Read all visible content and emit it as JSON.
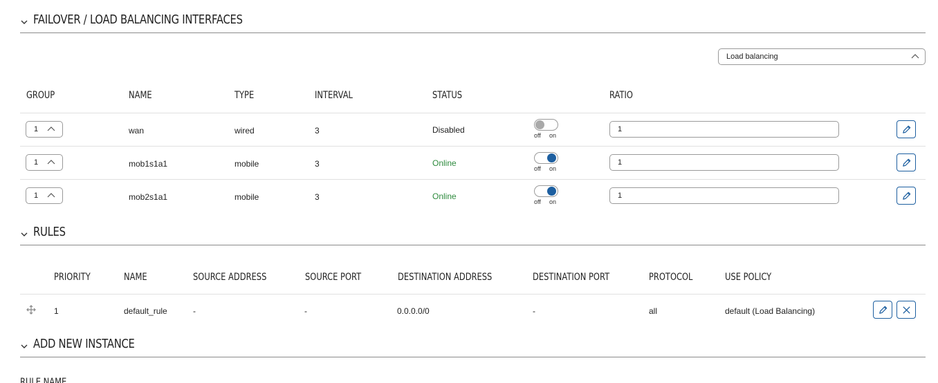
{
  "failover_section": {
    "title": "FAILOVER / LOAD BALANCING INTERFACES"
  },
  "mode_select": {
    "value": "Load balancing"
  },
  "interfaces": {
    "headers": {
      "group": "GROUP",
      "name": "NAME",
      "type": "TYPE",
      "interval": "INTERVAL",
      "status": "STATUS",
      "ratio": "RATIO"
    },
    "rows": [
      {
        "group": "1",
        "name": "wan",
        "type": "wired",
        "interval": "3",
        "status": "Disabled",
        "enabled": false,
        "toggle_off": "off",
        "toggle_on": "on",
        "ratio": "1"
      },
      {
        "group": "1",
        "name": "mob1s1a1",
        "type": "mobile",
        "interval": "3",
        "status": "Online",
        "enabled": true,
        "toggle_off": "off",
        "toggle_on": "on",
        "ratio": "1"
      },
      {
        "group": "1",
        "name": "mob2s1a1",
        "type": "mobile",
        "interval": "3",
        "status": "Online",
        "enabled": true,
        "toggle_off": "off",
        "toggle_on": "on",
        "ratio": "1"
      }
    ]
  },
  "rules_section": {
    "title": "RULES"
  },
  "rules": {
    "headers": {
      "priority": "PRIORITY",
      "name": "NAME",
      "source_address": "SOURCE ADDRESS",
      "source_port": "SOURCE PORT",
      "destination_address": "DESTINATION ADDRESS",
      "destination_port": "DESTINATION PORT",
      "protocol": "PROTOCOL",
      "use_policy": "USE POLICY"
    },
    "rows": [
      {
        "priority": "1",
        "name": "default_rule",
        "source_address": "-",
        "source_port": "-",
        "destination_address": "0.0.0.0/0",
        "destination_port": "-",
        "protocol": "all",
        "use_policy": "default (Load Balancing)"
      }
    ]
  },
  "add_section": {
    "title": "ADD NEW INSTANCE",
    "field_label": "RULE NAME"
  },
  "colors": {
    "accent": "#1d5fa0",
    "online": "#2e8b3e",
    "toggle_off_knob": "#a9a9a9"
  },
  "icons": {
    "section_toggle": "chevron-down-icon",
    "select_caret": "chevron-up-icon",
    "edit": "pencil-icon",
    "delete": "close-icon",
    "drag": "move-icon"
  }
}
